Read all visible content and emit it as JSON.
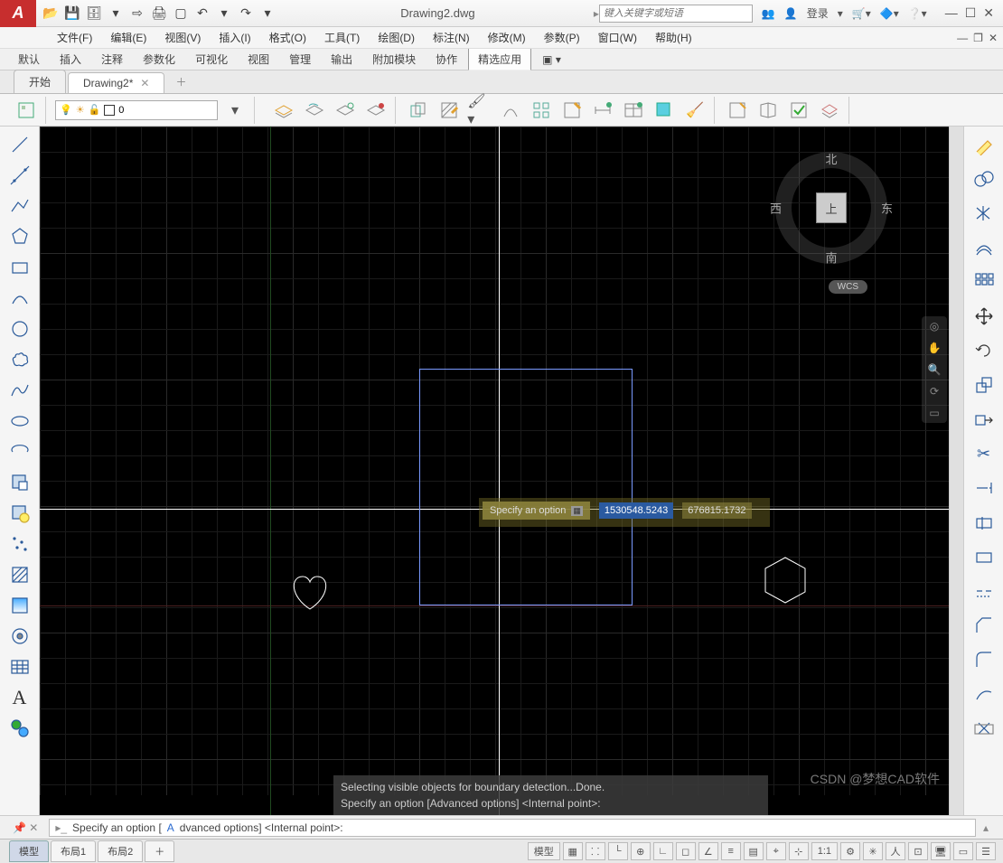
{
  "title": "Drawing2.dwg",
  "search_placeholder": "键入关键字或短语",
  "login": "登录",
  "menus": [
    "文件(F)",
    "编辑(E)",
    "视图(V)",
    "插入(I)",
    "格式(O)",
    "工具(T)",
    "绘图(D)",
    "标注(N)",
    "修改(M)",
    "参数(P)",
    "窗口(W)",
    "帮助(H)"
  ],
  "ribbon_tabs": [
    "默认",
    "插入",
    "注释",
    "参数化",
    "可视化",
    "视图",
    "管理",
    "输出",
    "附加模块",
    "协作",
    "精选应用"
  ],
  "ribbon_active_index": 10,
  "file_tabs": {
    "start": "开始",
    "active": "Drawing2*"
  },
  "layer": {
    "current": "0"
  },
  "viewcube": {
    "n": "北",
    "s": "南",
    "e": "东",
    "w": "西",
    "top": "上",
    "wcs": "WCS"
  },
  "dynamic_input": {
    "prompt": "Specify an option",
    "val1": "1530548.5243",
    "val2": "676815.1732"
  },
  "cmd_history": {
    "line1": "Selecting visible objects for boundary detection...Done.",
    "line2": "Specify an option [Advanced options] <Internal point>:"
  },
  "cmdline": {
    "pre": "Specify an option [",
    "hl": "A",
    "post": "dvanced options] <Internal point>:"
  },
  "layout_tabs": [
    "模型",
    "布局1",
    "布局2"
  ],
  "status_right": {
    "model": "模型",
    "scale": "1:1"
  },
  "watermark": "CSDN @梦想CAD软件"
}
